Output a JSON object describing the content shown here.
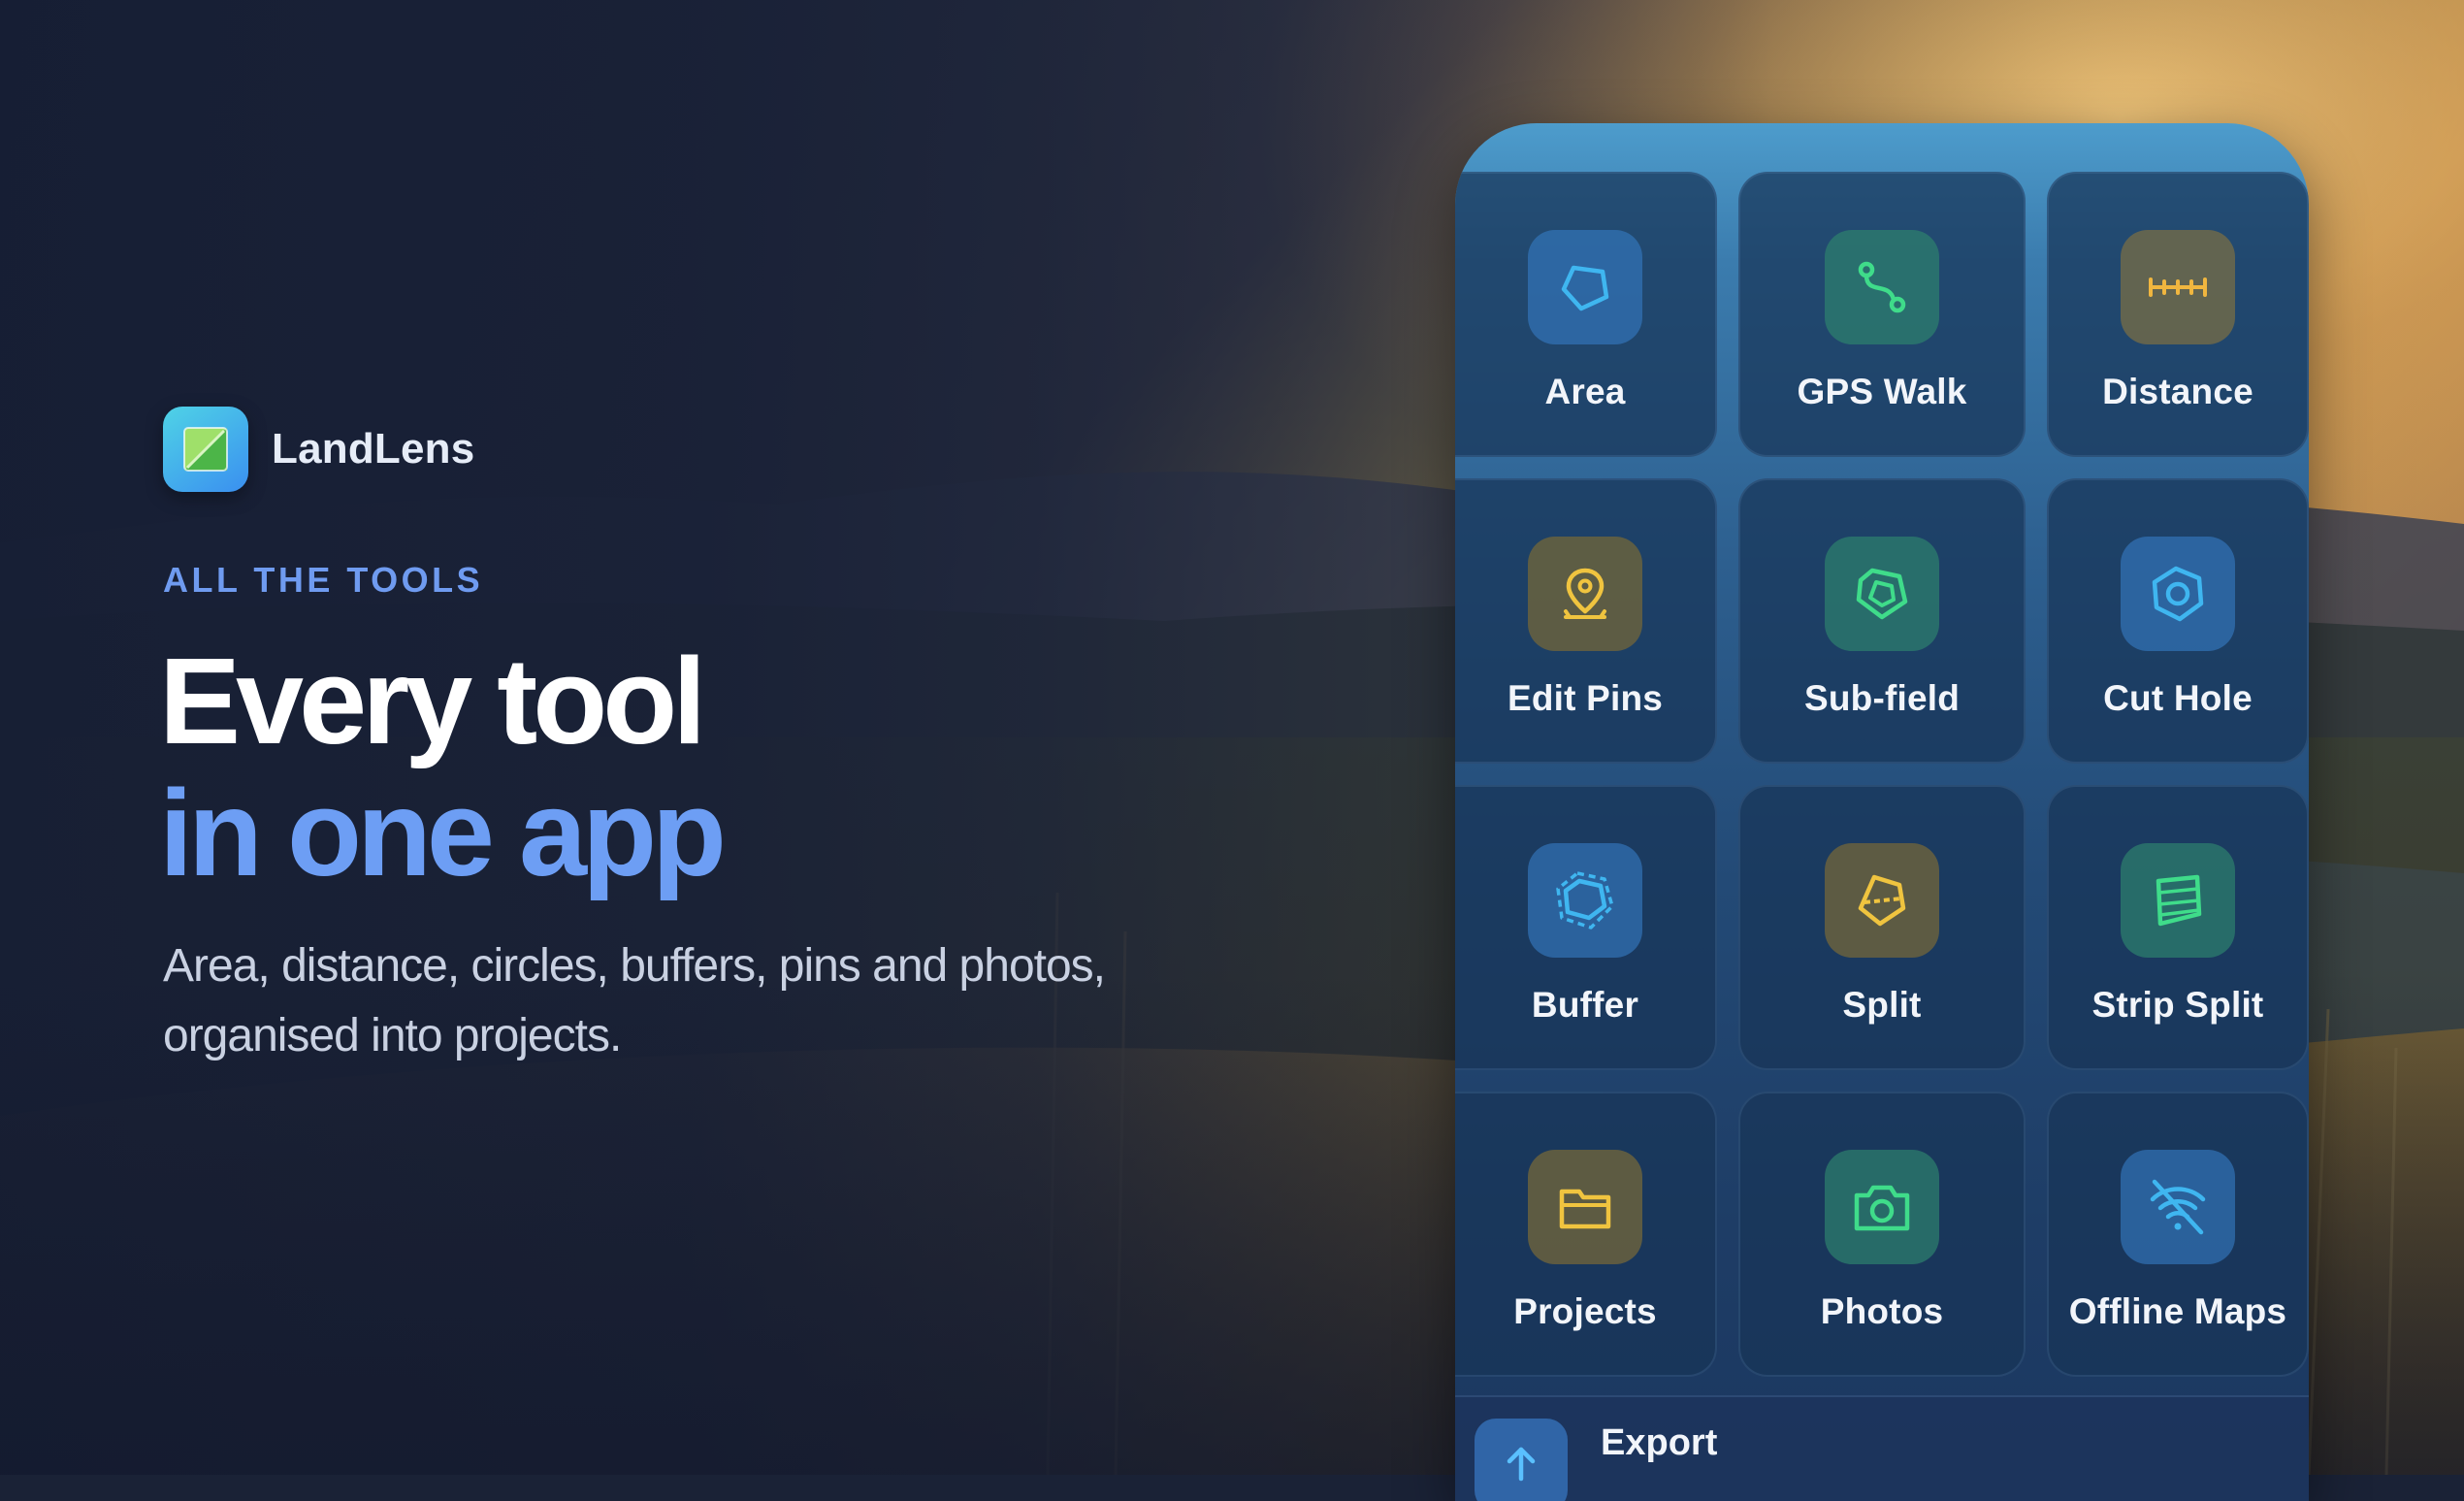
{
  "brand": {
    "name": "LandLens",
    "logo_icon": "landlens-logo-icon"
  },
  "hero": {
    "eyebrow": "ALL THE TOOLS",
    "headline_line1": "Every tool",
    "headline_line2": "in one app",
    "subcopy": "Area, distance, circles, buffers, pins and photos, organised into projects."
  },
  "tools": [
    {
      "label": "Area",
      "icon": "polygon-icon",
      "color": "#3fb6f0"
    },
    {
      "label": "GPS Walk",
      "icon": "route-icon",
      "color": "#3fdc8a"
    },
    {
      "label": "Distance",
      "icon": "ruler-icon",
      "color": "#f0b63f"
    },
    {
      "label": "Edit Pins",
      "icon": "map-pin-icon",
      "color": "#f0c43f"
    },
    {
      "label": "Sub-field",
      "icon": "nested-polygon-icon",
      "color": "#3fdc8a"
    },
    {
      "label": "Cut Hole",
      "icon": "polygon-hole-icon",
      "color": "#3fb6f0"
    },
    {
      "label": "Buffer",
      "icon": "buffer-polygon-icon",
      "color": "#3fb6f0"
    },
    {
      "label": "Split",
      "icon": "split-polygon-icon",
      "color": "#f0c43f"
    },
    {
      "label": "Strip Split",
      "icon": "strip-split-icon",
      "color": "#3fdc8a"
    },
    {
      "label": "Projects",
      "icon": "folder-icon",
      "color": "#f0c43f"
    },
    {
      "label": "Photos",
      "icon": "camera-icon",
      "color": "#3fdc8a"
    },
    {
      "label": "Offline Maps",
      "icon": "wifi-off-icon",
      "color": "#3fb6f0"
    }
  ],
  "export": {
    "label": "Export",
    "icon": "upload-icon"
  },
  "colors": {
    "accent": "#6d9ef4",
    "eyebrow": "#6f9bf0"
  }
}
